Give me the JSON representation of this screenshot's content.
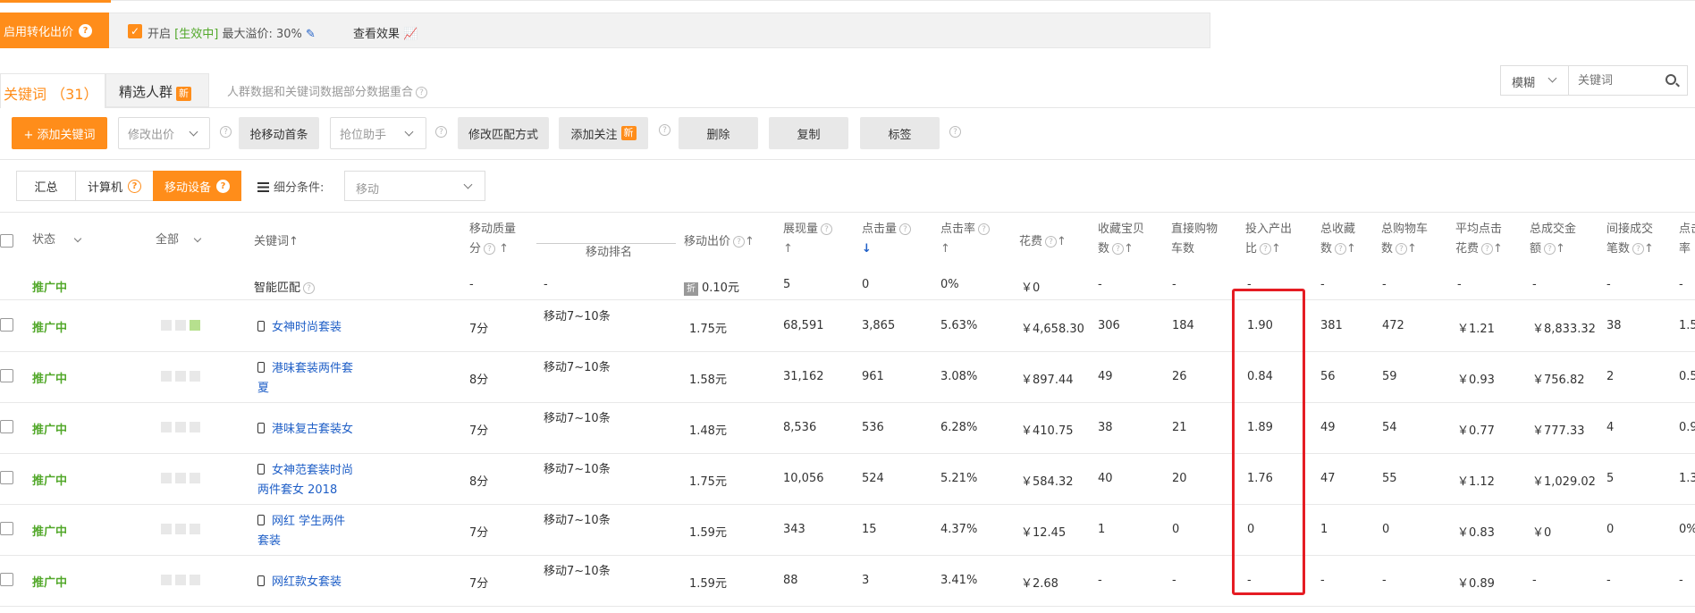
{
  "banner": {
    "button_label": "启用转化出价",
    "enabled_label": "开启",
    "status_label": "[生效中]",
    "max_premium": "最大溢价: 30%",
    "view_effect": "查看效果"
  },
  "tabs": {
    "keywords_label": "关键词 （31）",
    "crowd_label": "精选人群",
    "crowd_badge": "新",
    "note": "人群数据和关键词数据部分数据重合"
  },
  "search": {
    "mode": "模糊",
    "placeholder": "关键词"
  },
  "toolbar": {
    "add_keyword": "+ 添加关键词",
    "modify_bid": "修改出价",
    "grab_first": "抢移动首条",
    "rank_helper": "抢位助手",
    "modify_match": "修改匹配方式",
    "add_follow": "添加关注",
    "add_follow_badge": "新",
    "delete": "删除",
    "copy": "复制",
    "tag": "标签"
  },
  "segments": {
    "summary": "汇总",
    "computer": "计算机",
    "mobile": "移动设备",
    "condition_label": "细分条件:",
    "condition_value": "移动"
  },
  "headers": {
    "status": "状态",
    "all": "全部",
    "keyword": "关键词↑",
    "quality_1": "移动质量",
    "quality_2": "分",
    "rank": "移动排名",
    "bid": "移动出价",
    "impressions": "展现量",
    "clicks": "点击量",
    "ctr": "点击率",
    "cost": "花费",
    "fav_items_1": "收藏宝贝",
    "fav_items_2": "数",
    "cart_1": "直接购物",
    "cart_2": "车数",
    "roi_1": "投入产出",
    "roi_2": "比",
    "total_fav_1": "总收藏",
    "total_fav_2": "数",
    "total_cart_1": "总购物车",
    "total_cart_2": "数",
    "avg_click_1": "平均点击",
    "avg_click_2": "花费",
    "total_amount_1": "总成交金",
    "total_amount_2": "额",
    "indirect_1": "间接成交",
    "indirect_2": "笔数",
    "conv_1": "点击",
    "conv_2": "率"
  },
  "smart_row": {
    "status": "推广中",
    "keyword": "智能匹配",
    "quality": "-",
    "rank": "-",
    "bid_tag": "折",
    "bid": "0.10元",
    "impressions": "5",
    "clicks": "0",
    "ctr": "0%",
    "cost": "￥0",
    "fav_items": "-",
    "cart": "-",
    "roi": "-",
    "total_fav": "-",
    "total_cart": "-",
    "avg_click": "-",
    "total_amount": "-",
    "indirect": "-",
    "conv": "-"
  },
  "rows": [
    {
      "status": "推广中",
      "kw1": "女神时尚套装",
      "kw2": "",
      "quality": "7分",
      "rank": "移动7~10条",
      "bid": "1.75元",
      "impressions": "68,591",
      "clicks": "3,865",
      "ctr": "5.63%",
      "cost": "￥4,658.30",
      "fav_items": "306",
      "cart": "184",
      "roi": "1.90",
      "total_fav": "381",
      "total_cart": "472",
      "avg_click": "￥1.21",
      "total_amount": "￥8,833.32",
      "indirect": "38",
      "conv": "1.5"
    },
    {
      "status": "推广中",
      "kw1": "港味套装两件套",
      "kw2": "夏",
      "quality": "8分",
      "rank": "移动7~10条",
      "bid": "1.58元",
      "impressions": "31,162",
      "clicks": "961",
      "ctr": "3.08%",
      "cost": "￥897.44",
      "fav_items": "49",
      "cart": "26",
      "roi": "0.84",
      "total_fav": "56",
      "total_cart": "59",
      "avg_click": "￥0.93",
      "total_amount": "￥756.82",
      "indirect": "2",
      "conv": "0.5"
    },
    {
      "status": "推广中",
      "kw1": "港味复古套装女",
      "kw2": "",
      "quality": "7分",
      "rank": "移动7~10条",
      "bid": "1.48元",
      "impressions": "8,536",
      "clicks": "536",
      "ctr": "6.28%",
      "cost": "￥410.75",
      "fav_items": "38",
      "cart": "21",
      "roi": "1.89",
      "total_fav": "49",
      "total_cart": "54",
      "avg_click": "￥0.77",
      "total_amount": "￥777.33",
      "indirect": "4",
      "conv": "0.9"
    },
    {
      "status": "推广中",
      "kw1": "女神范套装时尚",
      "kw2": "两件套女 2018",
      "quality": "8分",
      "rank": "移动7~10条",
      "bid": "1.75元",
      "impressions": "10,056",
      "clicks": "524",
      "ctr": "5.21%",
      "cost": "￥584.32",
      "fav_items": "40",
      "cart": "20",
      "roi": "1.76",
      "total_fav": "47",
      "total_cart": "55",
      "avg_click": "￥1.12",
      "total_amount": "￥1,029.02",
      "indirect": "5",
      "conv": "1.3"
    },
    {
      "status": "推广中",
      "kw1": "网红 学生两件",
      "kw2": "套装",
      "quality": "7分",
      "rank": "移动7~10条",
      "bid": "1.59元",
      "impressions": "343",
      "clicks": "15",
      "ctr": "4.37%",
      "cost": "￥12.45",
      "fav_items": "1",
      "cart": "0",
      "roi": "0",
      "total_fav": "1",
      "total_cart": "0",
      "avg_click": "￥0.83",
      "total_amount": "￥0",
      "indirect": "0",
      "conv": "0%"
    },
    {
      "status": "推广中",
      "kw1": "网红款女套装",
      "kw2": "",
      "quality": "7分",
      "rank": "移动7~10条",
      "bid": "1.59元",
      "impressions": "88",
      "clicks": "3",
      "ctr": "3.41%",
      "cost": "￥2.68",
      "fav_items": "-",
      "cart": "-",
      "roi": "-",
      "total_fav": "-",
      "total_cart": "-",
      "avg_click": "￥0.89",
      "total_amount": "-",
      "indirect": "-",
      "conv": "-"
    }
  ],
  "colors": {
    "accent": "#ff8d1a",
    "status_green": "#52a82a",
    "link_blue": "#1f5fc7",
    "highlight_red": "#e51c23"
  }
}
